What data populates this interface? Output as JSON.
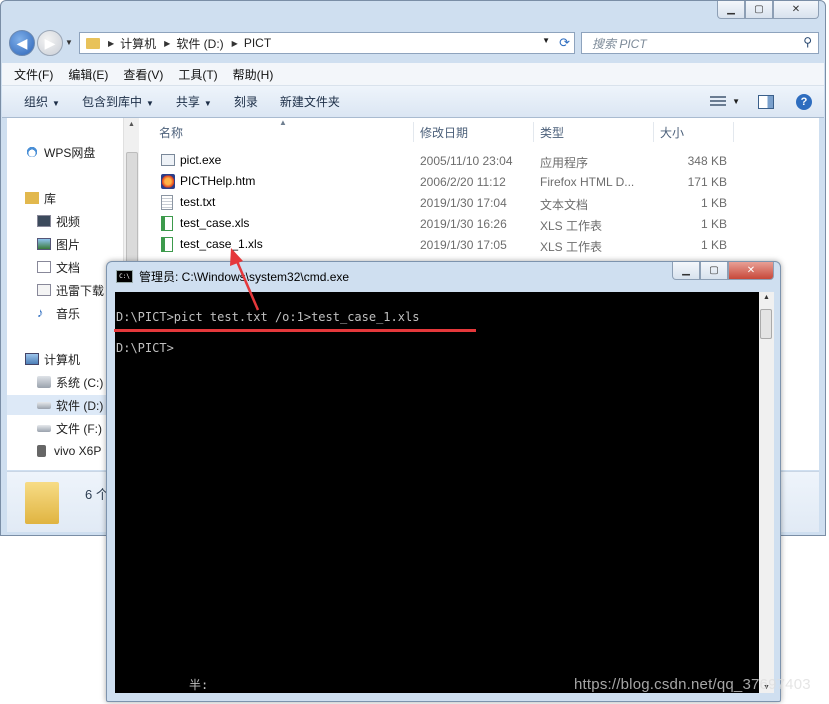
{
  "explorer": {
    "breadcrumb": [
      "计算机",
      "软件 (D:)",
      "PICT"
    ],
    "search_placeholder": "搜索 PICT",
    "menu": [
      "文件(F)",
      "编辑(E)",
      "查看(V)",
      "工具(T)",
      "帮助(H)"
    ],
    "toolbar": [
      "组织",
      "包含到库中",
      "共享",
      "刻录",
      "新建文件夹"
    ],
    "nav": {
      "items": [
        {
          "label": "WPS网盘",
          "icon": "cloud-icon"
        },
        {
          "label": "库",
          "icon": "library-icon"
        },
        {
          "label": "视频",
          "icon": "video-icon"
        },
        {
          "label": "图片",
          "icon": "picture-icon"
        },
        {
          "label": "文档",
          "icon": "document-icon"
        },
        {
          "label": "迅雷下载",
          "icon": "download-icon"
        },
        {
          "label": "音乐",
          "icon": "music-icon"
        },
        {
          "label": "计算机",
          "icon": "computer-icon"
        },
        {
          "label": "系统 (C:)",
          "icon": "drive-icon"
        },
        {
          "label": "软件 (D:)",
          "icon": "drive-icon"
        },
        {
          "label": "文件 (F:)",
          "icon": "drive-icon"
        },
        {
          "label": "vivo X6P",
          "icon": "phone-icon"
        }
      ]
    },
    "columns": [
      "名称",
      "修改日期",
      "类型",
      "大小"
    ],
    "files": [
      {
        "name": "pict.exe",
        "date": "2005/11/10 23:04",
        "type": "应用程序",
        "size": "348 KB",
        "icon": "exe-icon"
      },
      {
        "name": "PICTHelp.htm",
        "date": "2006/2/20 11:12",
        "type": "Firefox HTML D...",
        "size": "171 KB",
        "icon": "firefox-icon"
      },
      {
        "name": "test.txt",
        "date": "2019/1/30 17:04",
        "type": "文本文档",
        "size": "1 KB",
        "icon": "txt-icon"
      },
      {
        "name": "test_case.xls",
        "date": "2019/1/30 16:26",
        "type": "XLS 工作表",
        "size": "1 KB",
        "icon": "xls-icon"
      },
      {
        "name": "test_case_1.xls",
        "date": "2019/1/30 17:05",
        "type": "XLS 工作表",
        "size": "1 KB",
        "icon": "xls-icon"
      }
    ],
    "details_count": "6 个"
  },
  "cmd": {
    "title": "管理员: C:\\Windows\\system32\\cmd.exe",
    "lines": [
      "D:\\PICT>pict test.txt /o:1>test_case_1.xls",
      "D:\\PICT>"
    ],
    "ime": "半:"
  },
  "watermark": "https://blog.csdn.net/qq_37697403",
  "colors": {
    "annotation": "#e5383b",
    "console_bg": "#000000",
    "console_fg": "#c0c0c0"
  }
}
